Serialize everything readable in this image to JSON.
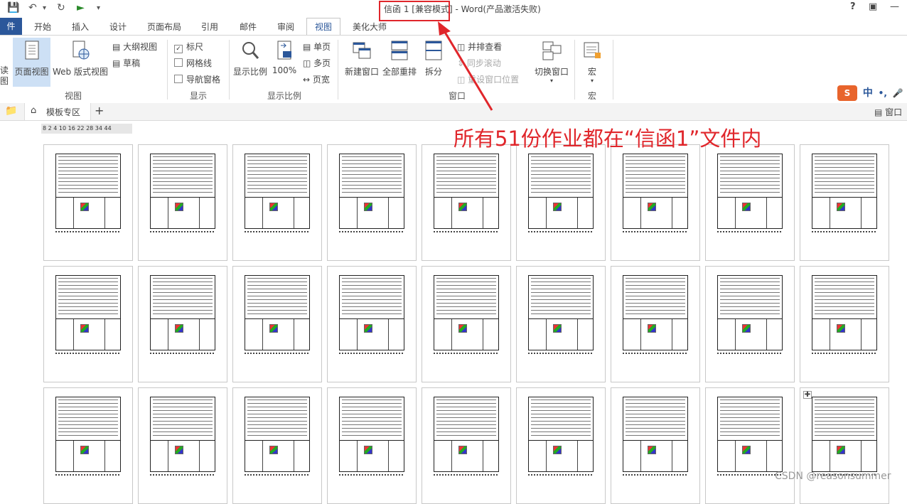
{
  "window": {
    "title": "信函 1 [兼容模式] - Word(产品激活失败)",
    "help": "?"
  },
  "ribbon_tabs": [
    "开始",
    "插入",
    "设计",
    "页面布局",
    "引用",
    "邮件",
    "审阅",
    "视图",
    "美化大师"
  ],
  "file_tab": "件",
  "active_tab": "视图",
  "groups": {
    "view": {
      "label": "视图",
      "read_partial": "读",
      "read_partial2": "图",
      "print_layout": "页面视图",
      "web_layout": "Web 版式视图",
      "outline": "大纲视图",
      "draft": "草稿"
    },
    "show": {
      "label": "显示",
      "ruler": "标尺",
      "gridlines": "网格线",
      "nav_pane": "导航窗格",
      "ruler_checked": true
    },
    "zoom": {
      "label": "显示比例",
      "zoom": "显示比例",
      "hundred": "100%",
      "one_page": "单页",
      "multi_page": "多页",
      "page_width": "页宽"
    },
    "window": {
      "label": "窗口",
      "new_window": "新建窗口",
      "arrange_all": "全部重排",
      "split": "拆分",
      "side_by_side": "并排查看",
      "sync_scroll": "同步滚动",
      "reset_pos": "重设窗口位置",
      "switch_windows": "切换窗口"
    },
    "macros": {
      "label": "宏",
      "macros": "宏"
    }
  },
  "ime": {
    "mode": "中",
    "punct": "•,"
  },
  "doc_tabs": {
    "template": "模板专区",
    "add": "+",
    "window_label": "窗口"
  },
  "ruler_text": "8  2  4  10 16 22 28 34   44",
  "annotation": "所有51份作业都在“信函1”文件内",
  "watermark": "CSDN @reasonsummer",
  "colors": {
    "accent": "#2b579a",
    "annotation": "#e0262b",
    "selected_view": "#cde0f5"
  },
  "page_grid": {
    "rows": 3,
    "cols": 9
  }
}
